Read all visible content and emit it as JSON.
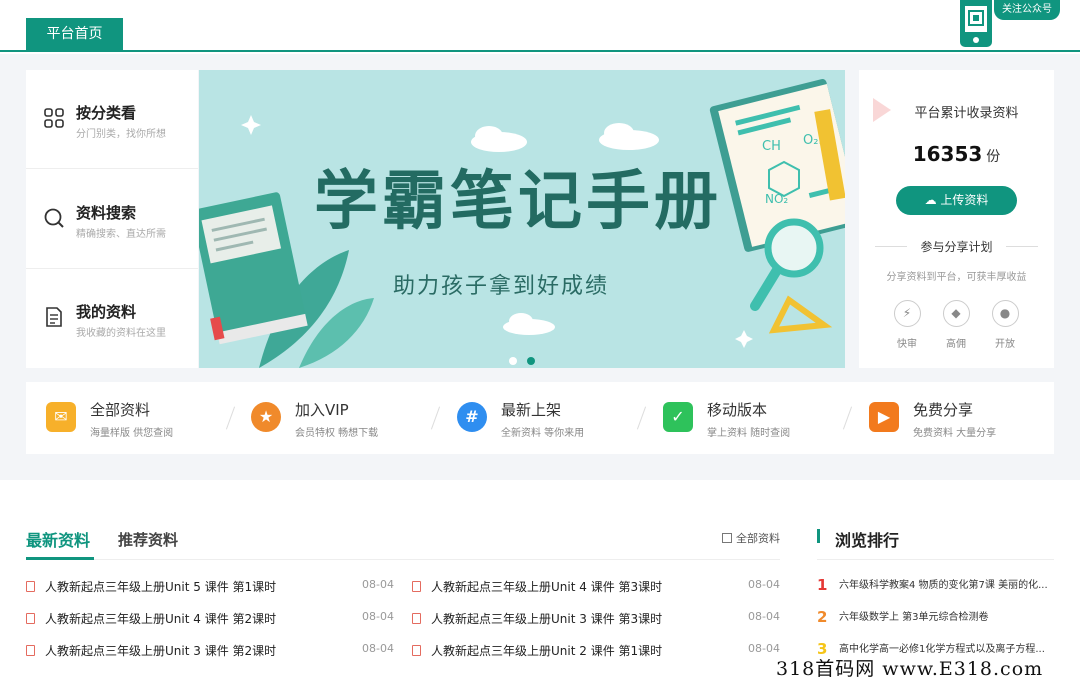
{
  "nav": {
    "home_tab": "平台首页",
    "follow_label": "关注公众号"
  },
  "categories": [
    {
      "title": "按分类看",
      "sub": "分门别类，找你所想",
      "icon": "grid-icon"
    },
    {
      "title": "资料搜索",
      "sub": "精确搜索、直达所需",
      "icon": "search-icon"
    },
    {
      "title": "我的资料",
      "sub": "我收藏的资料在这里",
      "icon": "document-icon"
    }
  ],
  "banner": {
    "title": "学霸笔记手册",
    "subtitle": "助力孩子拿到好成绩",
    "formula_ch": "CH",
    "formula_o2n": "O₂N",
    "formula_no2": "NO₂"
  },
  "stats": {
    "label": "平台累计收录资料",
    "count": "16353",
    "unit": "份",
    "upload_label": "上传资料",
    "share_title": "参与分享计划",
    "share_desc": "分享资料到平台，可获丰厚收益",
    "perks": [
      "快审",
      "高佣",
      "开放"
    ]
  },
  "features": [
    {
      "title": "全部资料",
      "sub": "海量样版 供您查阅",
      "icon": "mail-icon",
      "color": "#f7b02a"
    },
    {
      "title": "加入VIP",
      "sub": "会员特权 畅想下载",
      "icon": "medal-icon",
      "color": "#f08a2b"
    },
    {
      "title": "最新上架",
      "sub": "全新资料 等你来用",
      "icon": "hash-icon",
      "color": "#2f8ef0"
    },
    {
      "title": "移动版本",
      "sub": "掌上资料 随时查阅",
      "icon": "bag-icon",
      "color": "#2ec25b"
    },
    {
      "title": "免费分享",
      "sub": "免费资料 大量分享",
      "icon": "play-icon",
      "color": "#f27a1d"
    }
  ],
  "latest": {
    "tab_active": "最新资料",
    "tab_other": "推荐资料",
    "all_link": "全部资料",
    "docs": [
      {
        "title": "人教新起点三年级上册Unit 5 课件 第1课时",
        "date": "08-04"
      },
      {
        "title": "人教新起点三年级上册Unit 4 课件 第3课时",
        "date": "08-04"
      },
      {
        "title": "人教新起点三年级上册Unit 4 课件 第2课时",
        "date": "08-04"
      },
      {
        "title": "人教新起点三年级上册Unit 3 课件 第3课时",
        "date": "08-04"
      },
      {
        "title": "人教新起点三年级上册Unit 3 课件 第2课时",
        "date": "08-04"
      },
      {
        "title": "人教新起点三年级上册Unit 2 课件 第1课时",
        "date": "08-04"
      }
    ]
  },
  "ranking": {
    "title": "浏览排行",
    "items": [
      {
        "n": "1",
        "title": "六年级科学教案4 物质的变化第7课 美丽的化...",
        "color": "#e53935"
      },
      {
        "n": "2",
        "title": "六年级数学上 第3单元综合检测卷",
        "color": "#f08a2b"
      },
      {
        "n": "3",
        "title": "高中化学高一必修1化学方程式以及离子方程...",
        "color": "#f5c518"
      }
    ]
  },
  "watermark": "318首码网 www.E318.com"
}
